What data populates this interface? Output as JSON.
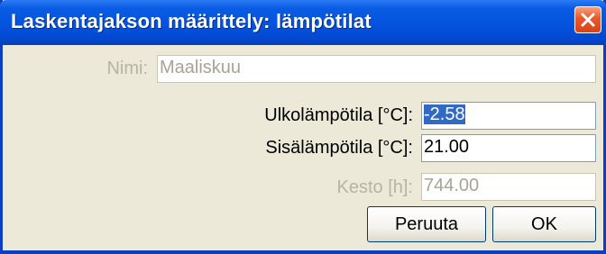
{
  "dialog": {
    "title": "Laskentajakson määrittely: lämpötilat",
    "close_icon": "close-icon"
  },
  "form": {
    "name_label": "Nimi:",
    "name_value": "Maaliskuu",
    "outdoor_label": "Ulkolämpötila [°C]:",
    "outdoor_value": "-2.58",
    "indoor_label": "Sisälämpötila [°C]:",
    "indoor_value": "21.00",
    "duration_label": "Kesto [h]:",
    "duration_value": "744.00"
  },
  "buttons": {
    "cancel_label": "Peruuta",
    "ok_label": "OK"
  }
}
